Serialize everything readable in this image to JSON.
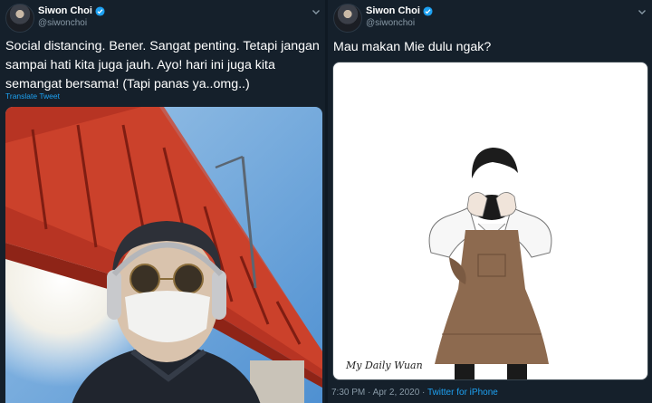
{
  "tweets": [
    {
      "author": {
        "name": "Siwon Choi",
        "handle": "@siwonchoi"
      },
      "text": "Social distancing. Bener. Sangat penting. Tetapi jangan sampai hati kita juga jauh. Ayo! hari ini juga kita semangat bersama! (Tapi panas ya..omg..)",
      "translate": "Translate Tweet",
      "media": "selfie-photo"
    },
    {
      "author": {
        "name": "Siwon Choi",
        "handle": "@siwonchoi"
      },
      "text": "Mau makan Mie dulu ngak?",
      "media": "drawing",
      "drawing_signature": "My Daily Wuan",
      "footer": {
        "time": "7:30 PM · Apr 2, 2020 · ",
        "source": "Twitter for iPhone"
      }
    }
  ],
  "colors": {
    "background": "#15202b",
    "link": "#1da1f2",
    "secondary_text": "#8899a6",
    "verified": "#1da1f2"
  }
}
